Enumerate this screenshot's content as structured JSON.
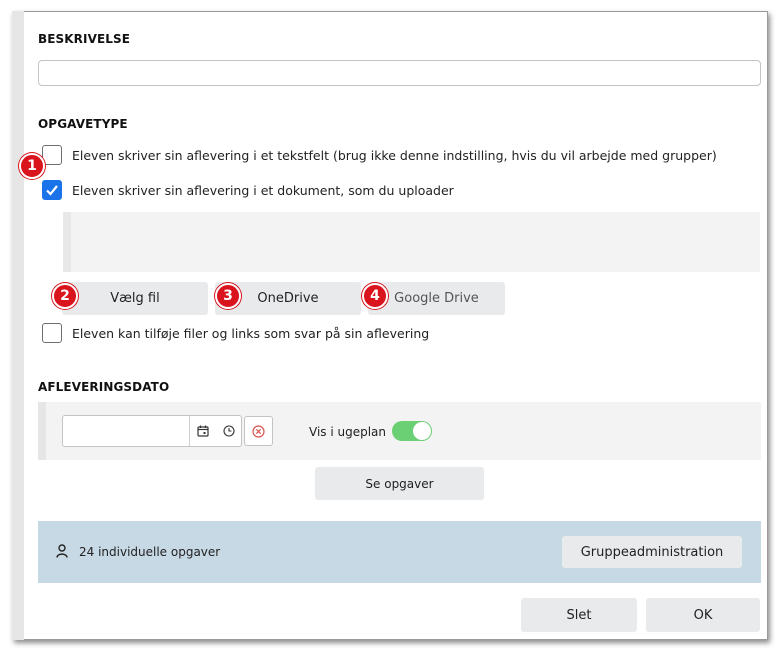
{
  "sections": {
    "description_heading": "BESKRIVELSE",
    "task_type_heading": "OPGAVETYPE",
    "due_date_heading": "AFLEVERINGSDATO"
  },
  "description": {
    "value": "",
    "placeholder": ""
  },
  "options": [
    {
      "label": "Eleven skriver sin aflevering i et tekstfelt (brug ikke denne indstilling, hvis du vil arbejde med grupper)",
      "checked": false
    },
    {
      "label": "Eleven skriver sin aflevering i et dokument, som du uploader",
      "checked": true
    },
    {
      "label": "Eleven kan tilføje filer og links som svar på sin aflevering",
      "checked": false
    }
  ],
  "upload_buttons": {
    "choose_file": "Vælg fil",
    "onedrive": "OneDrive",
    "google_drive": "Google Drive"
  },
  "badges": [
    "1",
    "2",
    "3",
    "4"
  ],
  "date": {
    "value": ""
  },
  "show_in_weekplan": {
    "label": "Vis i ugeplan",
    "on": true
  },
  "see_tasks_button": "Se opgaver",
  "info_bar": {
    "text": "24 individuelle opgaver",
    "button": "Gruppeadministration",
    "color": "#c8d9e6"
  },
  "footer": {
    "delete": "Slet",
    "ok": "OK"
  },
  "colors": {
    "accent": "#1a73e8",
    "badge": "#d9141d",
    "toggle_on": "#6bcf74"
  },
  "icons": [
    "check-icon",
    "calendar-icon",
    "clock-icon",
    "clear-icon",
    "user-icon"
  ]
}
